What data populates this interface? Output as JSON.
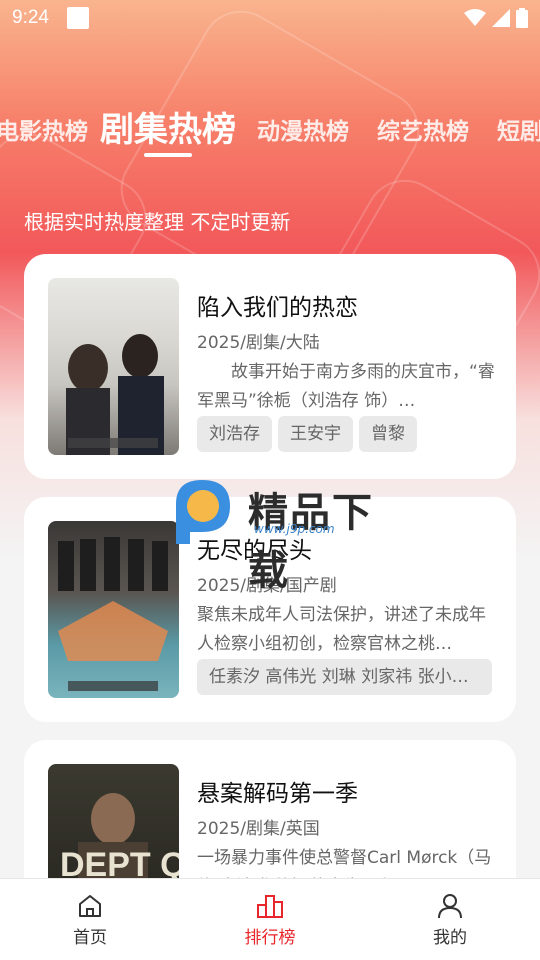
{
  "status_bar": {
    "time": "9:24"
  },
  "tabs": [
    {
      "label": "电影热榜",
      "active": false
    },
    {
      "label": "剧集热榜",
      "active": true
    },
    {
      "label": "动漫热榜",
      "active": false
    },
    {
      "label": "综艺热榜",
      "active": false
    },
    {
      "label": "短剧",
      "active": false
    }
  ],
  "subtitle": "根据实时热度整理 不定时更新",
  "cards": [
    {
      "title": "陷入我们的热恋",
      "meta": "2025/剧集/大陆",
      "desc": "　　故事开始于南方多雨的庆宜市，“睿军黑马”徐栀（刘浩存 饰）…",
      "tags": [
        "刘浩存",
        "王安宇",
        "曾黎"
      ]
    },
    {
      "title": "无尽的尽头",
      "meta": "2025/剧集/国产剧",
      "desc": "聚焦未成年人司法保护，讲述了未成年人检察小组初创，检察官林之桃…",
      "tags": [
        "任素汐 高伟光 刘琳 刘家祎 张小…"
      ]
    },
    {
      "title": "悬案解码第一季",
      "meta": "2025/剧集/英国",
      "desc": "一场暴力事件使总警督Carl Mørck（马修·麦法登 饰）的人生天翻",
      "tags": []
    }
  ],
  "watermark": {
    "text": "精品下载",
    "url": "www.j9p.com"
  },
  "bottom_nav": [
    {
      "label": "首页",
      "icon": "home-icon",
      "active": false
    },
    {
      "label": "排行榜",
      "icon": "ranking-icon",
      "active": true
    },
    {
      "label": "我的",
      "icon": "profile-icon",
      "active": false
    }
  ],
  "colors": {
    "accent": "#e8262b",
    "hero_top": "#f9b48e",
    "hero_mid": "#f2585a"
  }
}
